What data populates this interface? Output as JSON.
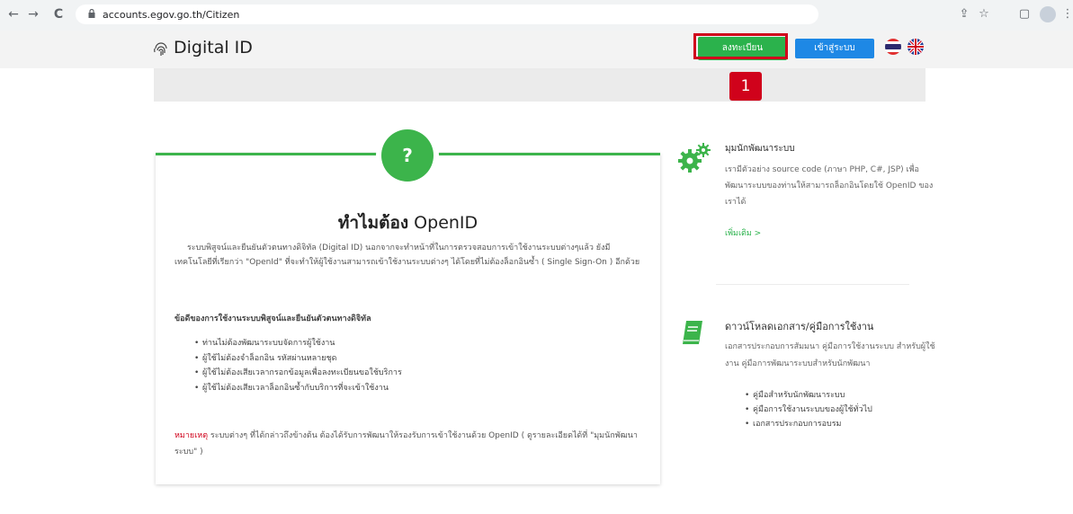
{
  "browser": {
    "url": "accounts.egov.go.th/Citizen",
    "back_icon": "←",
    "forward_icon": "→",
    "reload_icon": "C"
  },
  "header": {
    "logo_text": "Digital ID",
    "register_label": "ลงทะเบียน",
    "login_label": "เข้าสู่ระบบ",
    "step_number": "1"
  },
  "main_card": {
    "icon": "?",
    "title_thai": "ทำไมต้อง",
    "title_open": " OpenID",
    "intro": "ระบบพิสูจน์และยืนยันตัวตนทางดิจิทัล (Digital ID) นอกจากจะทำหน้าที่ในการตรวจสอบการเข้าใช้งานระบบต่างๆแล้ว ยังมีเทคโนโลยีที่เรียกว่า \"OpenId\" ที่จะทำให้ผู้ใช้งานสามารถเข้าใช้งานระบบต่างๆ ได้โดยที่ไม่ต้องล็อกอินซ้ำ ( Single Sign-On ) อีกด้วย",
    "benefits_heading": "ข้อดีของการใช้งานระบบพิสูจน์และยืนยันตัวตนทางดิจิทัล",
    "benefits": [
      "ท่านไม่ต้องพัฒนาระบบจัดการผู้ใช้งาน",
      "ผู้ใช้ไม่ต้องจำล็อกอิน รหัสผ่านหลายชุด",
      "ผู้ใช้ไม่ต้องเสียเวลากรอกข้อมูลเพื่อลงทะเบียนขอใช้บริการ",
      "ผู้ใช้ไม่ต้องเสียเวลาล็อกอินซ้ำกับบริการที่จะเข้าใช้งาน"
    ],
    "note_label": "หมายเหตุ",
    "note_text": " ระบบต่างๆ ที่ได้กล่าวถึงข้างต้น ต้องได้รับการพัฒนาให้รองรับการเข้าใช้งานด้วย OpenID ( ดูรายละเอียดได้ที่ \"มุมนักพัฒนาระบบ\" )"
  },
  "developer": {
    "title": "มุมนักพัฒนาระบบ",
    "description": "เรามีตัวอย่าง source code (ภาษา PHP, C#, JSP) เพื่อพัฒนาระบบของท่านให้สามารถล็อกอินโดยใช้ OpenID ของเราได้",
    "more_label": "เพิ่มเติม >"
  },
  "downloads": {
    "title": "ดาวน์โหลดเอกสาร/คู่มือการใช้งาน",
    "description": "เอกสารประกอบการสัมมนา คู่มือการใช้งานระบบ สำหรับผู้ใช้งาน คู่มือการพัฒนาระบบสำหรับนักพัฒนา",
    "items": [
      "คู่มือสำหรับนักพัฒนาระบบ",
      "คู่มือการใช้งานระบบของผู้ใช้ทั่วไป",
      "เอกสารประกอบการอบรม"
    ]
  },
  "colors": {
    "accent_green": "#3cb44b",
    "login_blue": "#1e88e5",
    "highlight_red": "#d0021b"
  }
}
